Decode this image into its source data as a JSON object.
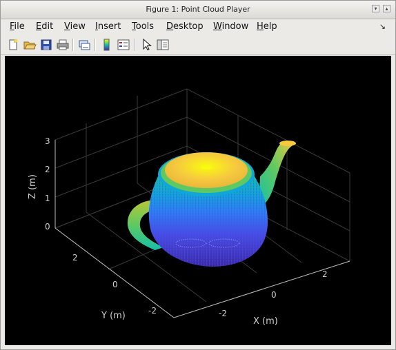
{
  "window": {
    "title": "Figure 1: Point Cloud Player"
  },
  "menu": {
    "items": [
      "File",
      "Edit",
      "View",
      "Insert",
      "Tools",
      "Desktop",
      "Window",
      "Help"
    ],
    "underlined": [
      "F",
      "E",
      "V",
      "I",
      "T",
      "D",
      "W",
      "H"
    ]
  },
  "toolbar": {
    "buttons": [
      "new-figure",
      "open-file",
      "save",
      "print",
      "link-plot",
      "insert-colorbar",
      "insert-legend",
      "edit-plot",
      "show-plot-tools"
    ]
  },
  "axes": {
    "zlabel": "Z (m)",
    "ylabel": "Y (m)",
    "xlabel": "X (m)",
    "zticks": [
      "3",
      "2",
      "1",
      "0"
    ],
    "yticks": [
      "2",
      "0",
      "-2"
    ],
    "xticks": [
      "-2",
      "0",
      "2"
    ],
    "background": "#000000",
    "tick_color": "#d0d0d0",
    "grid_color": "#3a3a3a"
  },
  "colormap": [
    "#3e26a8",
    "#4a49e4",
    "#2f7cf5",
    "#10a6d8",
    "#16bfa9",
    "#5ec962",
    "#bbc636",
    "#f6c93f",
    "#f9fb0e"
  ]
}
